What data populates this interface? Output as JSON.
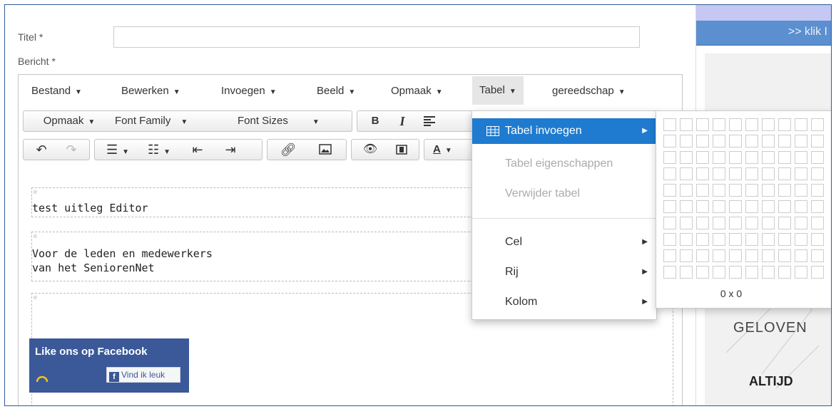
{
  "form": {
    "title_label": "Titel *",
    "message_label": "Bericht *"
  },
  "menubar": {
    "items": [
      {
        "label": "Bestand"
      },
      {
        "label": "Bewerken"
      },
      {
        "label": "Invoegen"
      },
      {
        "label": "Beeld"
      },
      {
        "label": "Opmaak"
      },
      {
        "label": "Tabel"
      },
      {
        "label": "gereedschap"
      }
    ]
  },
  "toolbar1": {
    "format_label": "Opmaak",
    "font_family_label": "Font Family",
    "font_sizes_label": "Font Sizes",
    "bold_label": "B",
    "italic_label": "I"
  },
  "toolbar2": {
    "font_color_label": "A"
  },
  "content": {
    "block_marker": "e",
    "paragraph1": "test uitleg Editor",
    "paragraph2_line1": "Voor de leden en medewerkers",
    "paragraph2_line2": "van het SeniorenNet",
    "facebook_title": "Like ons op Facebook",
    "facebook_button": "Vind ik leuk"
  },
  "table_menu": {
    "items": [
      {
        "label": "Tabel invoegen",
        "state": "selected",
        "submenu": true
      },
      {
        "label": "Tabel eigenschappen",
        "state": "disabled",
        "submenu": false
      },
      {
        "label": "Verwijder tabel",
        "state": "disabled",
        "submenu": false
      },
      {
        "label": "Cel",
        "state": "normal",
        "submenu": true
      },
      {
        "label": "Rij",
        "state": "normal",
        "submenu": true
      },
      {
        "label": "Kolom",
        "state": "normal",
        "submenu": true
      }
    ]
  },
  "grid_picker": {
    "size_label": "0 x 0",
    "columns": 10,
    "rows": 10
  },
  "sidebar": {
    "link": ">> klik I",
    "text1": "GELOVEN",
    "text2": "ALTIJD"
  },
  "colors": {
    "accent": "#1f7bd0",
    "facebook": "#3b5998",
    "frame": "#2e5c99",
    "link": "#1a66c9"
  }
}
